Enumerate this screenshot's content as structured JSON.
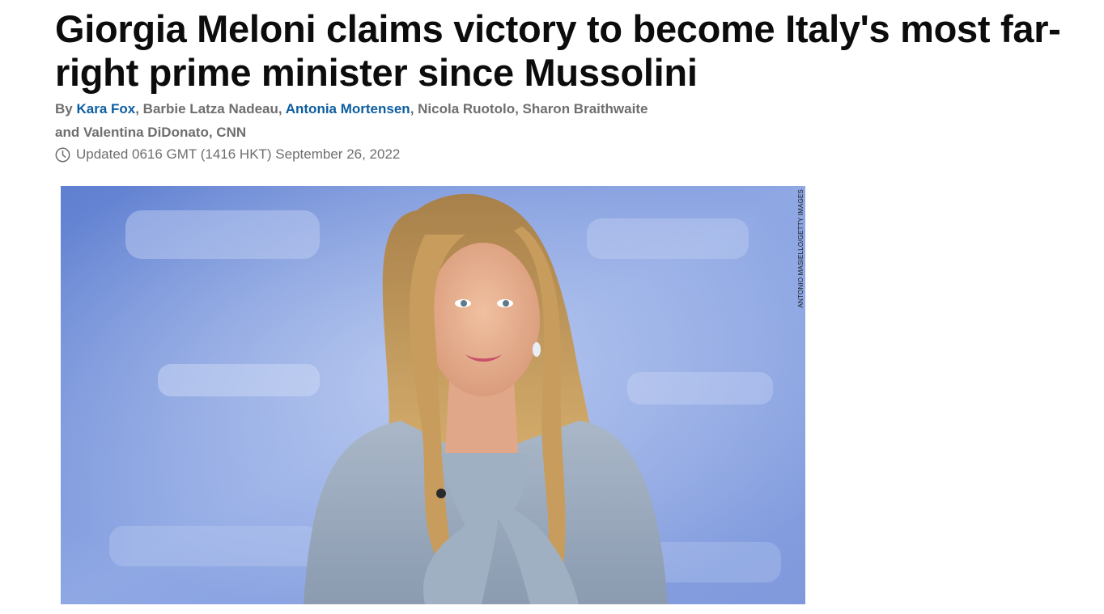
{
  "article": {
    "headline": "Giorgia Meloni claims victory to become Italy's most far-right prime minister since Mussolini",
    "byline": {
      "prefix": "By ",
      "author1": "Kara Fox",
      "sep1": ", ",
      "author2": "Barbie Latza Nadeau",
      "sep2": ", ",
      "author3": "Antonia Mortensen",
      "rest": ", Nicola Ruotolo, Sharon Braithwaite and Valentina DiDonato, CNN"
    },
    "updated": "Updated 0616 GMT (1416 HKT) September 26, 2022",
    "clock_icon": "clock-icon",
    "image": {
      "credit": "ANTONIO MASIELLO/GETTY IMAGES",
      "subject": "photo-of-giorgia-meloni"
    }
  },
  "colors": {
    "headline": "#0c0c0c",
    "byline_text": "#6e6e6e",
    "byline_link": "#0c5ea0",
    "photo_background": "#6f90d8"
  }
}
